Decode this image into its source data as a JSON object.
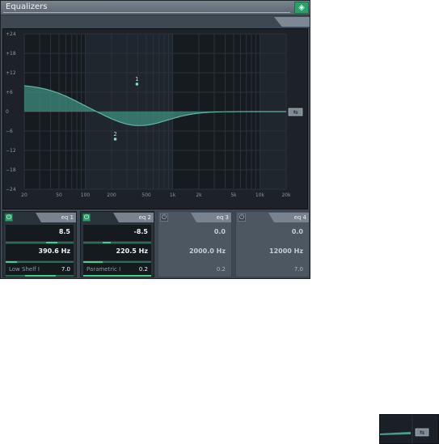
{
  "window": {
    "title": "Equalizers",
    "pin_icon": "pin-icon"
  },
  "graph": {
    "y_ticks": [
      "+24",
      "+18",
      "+12",
      "+6",
      "0",
      "−6",
      "−12",
      "−18",
      "−24"
    ],
    "x_ticks": [
      "20",
      "50",
      "100",
      "200",
      "500",
      "1k",
      "2k",
      "5k",
      "10k",
      "20k"
    ],
    "nodes": [
      {
        "label": "1",
        "freq": 390.6,
        "gain": 8.5
      },
      {
        "label": "2",
        "freq": 220.5,
        "gain": -8.5
      }
    ],
    "curve_color": "#5fb7a3",
    "reset_icon": "reset-icon"
  },
  "bands": [
    {
      "name": "eq 1",
      "enabled": true,
      "gain": "8.5",
      "freq": "390.6 Hz",
      "type": "Low Shelf I",
      "q": "7.0",
      "gain_level": 0.6,
      "freq_level": 0.35,
      "q_level": 0.7
    },
    {
      "name": "eq 2",
      "enabled": true,
      "gain": "-8.5",
      "freq": "220.5 Hz",
      "type": "Parametric I",
      "q": "0.2",
      "gain_level": 0.35,
      "freq_level": 0.3,
      "q_level": 1.0
    },
    {
      "name": "eq 3",
      "enabled": false,
      "gain": "0.0",
      "freq": "2000.0 Hz",
      "type": "",
      "q": "0.2"
    },
    {
      "name": "eq 4",
      "enabled": false,
      "gain": "0.0",
      "freq": "12000 Hz",
      "type": "",
      "q": "7.0"
    }
  ],
  "colors": {
    "accent": "#2e9e6a",
    "slider": "#43d08d",
    "background": "#3e4852"
  }
}
